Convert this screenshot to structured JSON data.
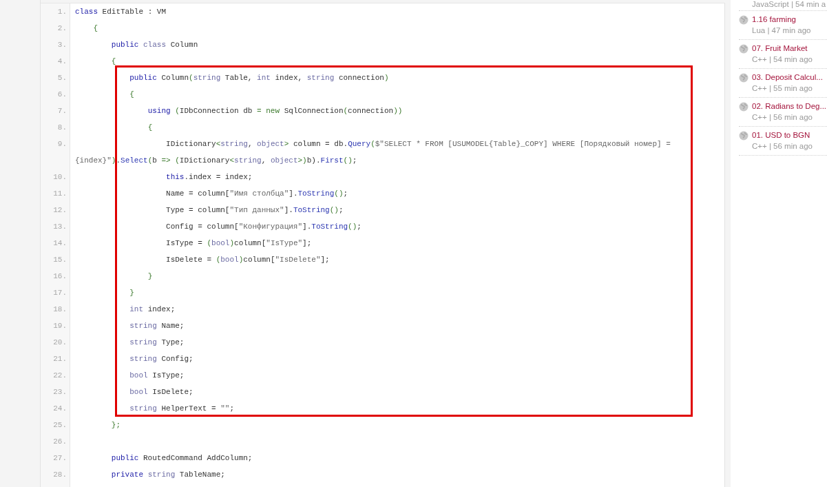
{
  "code": {
    "lines": [
      {
        "number": "1.",
        "tokens": [
          {
            "kind": "keyword",
            "text": "class"
          },
          {
            "kind": "plain",
            "text": " EditTable : VM"
          }
        ]
      },
      {
        "number": "2.",
        "tokens": [
          {
            "kind": "punct",
            "text": "    {"
          }
        ]
      },
      {
        "number": "3.",
        "tokens": [
          {
            "kind": "keyword",
            "text": "        public"
          },
          {
            "kind": "type",
            "text": " class"
          },
          {
            "kind": "plain",
            "text": " Column"
          }
        ]
      },
      {
        "number": "4.",
        "tokens": [
          {
            "kind": "punct",
            "text": "        {"
          }
        ]
      },
      {
        "number": "5.",
        "tokens": [
          {
            "kind": "keyword",
            "text": "            public"
          },
          {
            "kind": "plain",
            "text": " Column"
          },
          {
            "kind": "punct",
            "text": "("
          },
          {
            "kind": "type",
            "text": "string"
          },
          {
            "kind": "plain",
            "text": " Table, "
          },
          {
            "kind": "type",
            "text": "int"
          },
          {
            "kind": "plain",
            "text": " index, "
          },
          {
            "kind": "type",
            "text": "string"
          },
          {
            "kind": "plain",
            "text": " connection"
          },
          {
            "kind": "punct",
            "text": ")"
          }
        ]
      },
      {
        "number": "6.",
        "tokens": [
          {
            "kind": "punct",
            "text": "            {"
          }
        ]
      },
      {
        "number": "7.",
        "tokens": [
          {
            "kind": "keyword",
            "text": "                using"
          },
          {
            "kind": "punct",
            "text": " ("
          },
          {
            "kind": "plain",
            "text": "IDbConnection db "
          },
          {
            "kind": "punct",
            "text": "= new"
          },
          {
            "kind": "plain",
            "text": " SqlConnection"
          },
          {
            "kind": "punct",
            "text": "("
          },
          {
            "kind": "plain",
            "text": "connection"
          },
          {
            "kind": "punct",
            "text": "))"
          }
        ]
      },
      {
        "number": "8.",
        "tokens": [
          {
            "kind": "punct",
            "text": "                {"
          }
        ]
      },
      {
        "number": "9.",
        "tokens": [
          {
            "kind": "plain",
            "text": "                    IDictionary"
          },
          {
            "kind": "punct",
            "text": "<"
          },
          {
            "kind": "type",
            "text": "string"
          },
          {
            "kind": "plain",
            "text": ", "
          },
          {
            "kind": "type",
            "text": "object"
          },
          {
            "kind": "punct",
            "text": ">"
          },
          {
            "kind": "plain",
            "text": " column = db."
          },
          {
            "kind": "method",
            "text": "Query"
          },
          {
            "kind": "punct",
            "text": "("
          },
          {
            "kind": "string",
            "text": "$\"SELECT * FROM [USUMODEL{Table}_COPY] WHERE [Порядковый номер] = {index}\""
          },
          {
            "kind": "punct",
            "text": ")"
          },
          {
            "kind": "plain",
            "text": "."
          },
          {
            "kind": "method",
            "text": "Select"
          },
          {
            "kind": "punct",
            "text": "("
          },
          {
            "kind": "plain",
            "text": "b "
          },
          {
            "kind": "punct",
            "text": "=> ("
          },
          {
            "kind": "plain",
            "text": "IDictionary"
          },
          {
            "kind": "punct",
            "text": "<"
          },
          {
            "kind": "type",
            "text": "string"
          },
          {
            "kind": "plain",
            "text": ", "
          },
          {
            "kind": "type",
            "text": "object"
          },
          {
            "kind": "punct",
            "text": ">)"
          },
          {
            "kind": "plain",
            "text": "b)."
          },
          {
            "kind": "method",
            "text": "First"
          },
          {
            "kind": "punct",
            "text": "()"
          },
          {
            "kind": "plain",
            "text": ";"
          }
        ]
      },
      {
        "number": "10.",
        "tokens": [
          {
            "kind": "keyword",
            "text": "                    this"
          },
          {
            "kind": "plain",
            "text": ".index = index;"
          }
        ]
      },
      {
        "number": "11.",
        "tokens": [
          {
            "kind": "plain",
            "text": "                    Name = column["
          },
          {
            "kind": "string",
            "text": "\"Имя столбца\""
          },
          {
            "kind": "plain",
            "text": "]."
          },
          {
            "kind": "method",
            "text": "ToString"
          },
          {
            "kind": "punct",
            "text": "()"
          },
          {
            "kind": "plain",
            "text": ";"
          }
        ]
      },
      {
        "number": "12.",
        "tokens": [
          {
            "kind": "plain",
            "text": "                    Type = column["
          },
          {
            "kind": "string",
            "text": "\"Тип данных\""
          },
          {
            "kind": "plain",
            "text": "]."
          },
          {
            "kind": "method",
            "text": "ToString"
          },
          {
            "kind": "punct",
            "text": "()"
          },
          {
            "kind": "plain",
            "text": ";"
          }
        ]
      },
      {
        "number": "13.",
        "tokens": [
          {
            "kind": "plain",
            "text": "                    Config = column["
          },
          {
            "kind": "string",
            "text": "\"Конфигурация\""
          },
          {
            "kind": "plain",
            "text": "]."
          },
          {
            "kind": "method",
            "text": "ToString"
          },
          {
            "kind": "punct",
            "text": "()"
          },
          {
            "kind": "plain",
            "text": ";"
          }
        ]
      },
      {
        "number": "14.",
        "tokens": [
          {
            "kind": "plain",
            "text": "                    IsType = "
          },
          {
            "kind": "punct",
            "text": "("
          },
          {
            "kind": "type",
            "text": "bool"
          },
          {
            "kind": "punct",
            "text": ")"
          },
          {
            "kind": "plain",
            "text": "column["
          },
          {
            "kind": "string",
            "text": "\"IsType\""
          },
          {
            "kind": "plain",
            "text": "];"
          }
        ]
      },
      {
        "number": "15.",
        "tokens": [
          {
            "kind": "plain",
            "text": "                    IsDelete = "
          },
          {
            "kind": "punct",
            "text": "("
          },
          {
            "kind": "type",
            "text": "bool"
          },
          {
            "kind": "punct",
            "text": ")"
          },
          {
            "kind": "plain",
            "text": "column["
          },
          {
            "kind": "string",
            "text": "\"IsDelete\""
          },
          {
            "kind": "plain",
            "text": "];"
          }
        ]
      },
      {
        "number": "16.",
        "tokens": [
          {
            "kind": "punct",
            "text": "                }"
          }
        ]
      },
      {
        "number": "17.",
        "tokens": [
          {
            "kind": "punct",
            "text": "            }"
          }
        ]
      },
      {
        "number": "18.",
        "tokens": [
          {
            "kind": "type",
            "text": "            int"
          },
          {
            "kind": "plain",
            "text": " index;"
          }
        ]
      },
      {
        "number": "19.",
        "tokens": [
          {
            "kind": "type",
            "text": "            string"
          },
          {
            "kind": "plain",
            "text": " Name;"
          }
        ]
      },
      {
        "number": "20.",
        "tokens": [
          {
            "kind": "type",
            "text": "            string"
          },
          {
            "kind": "plain",
            "text": " Type;"
          }
        ]
      },
      {
        "number": "21.",
        "tokens": [
          {
            "kind": "type",
            "text": "            string"
          },
          {
            "kind": "plain",
            "text": " Config;"
          }
        ]
      },
      {
        "number": "22.",
        "tokens": [
          {
            "kind": "type",
            "text": "            bool"
          },
          {
            "kind": "plain",
            "text": " IsType;"
          }
        ]
      },
      {
        "number": "23.",
        "tokens": [
          {
            "kind": "type",
            "text": "            bool"
          },
          {
            "kind": "plain",
            "text": " IsDelete;"
          }
        ]
      },
      {
        "number": "24.",
        "tokens": [
          {
            "kind": "type",
            "text": "            string"
          },
          {
            "kind": "plain",
            "text": " HelperText = "
          },
          {
            "kind": "string",
            "text": "\"\""
          },
          {
            "kind": "plain",
            "text": ";"
          }
        ]
      },
      {
        "number": "25.",
        "tokens": [
          {
            "kind": "punct",
            "text": "        };"
          }
        ]
      },
      {
        "number": "26."
      },
      {
        "number": "27.",
        "tokens": [
          {
            "kind": "keyword",
            "text": "        public"
          },
          {
            "kind": "plain",
            "text": " RoutedCommand AddColumn;"
          }
        ]
      },
      {
        "number": "28.",
        "tokens": [
          {
            "kind": "keyword",
            "text": "        private"
          },
          {
            "kind": "type",
            "text": " string"
          },
          {
            "kind": "plain",
            "text": " TableName;"
          }
        ]
      }
    ]
  },
  "recent": [
    {
      "meta": "JavaScript | 54 min a"
    },
    {
      "title": "1.16 farming",
      "meta": "Lua | 47 min ago"
    },
    {
      "title": "07. Fruit Market",
      "meta": "C++ | 54 min ago"
    },
    {
      "title": "03. Deposit Calcul...",
      "meta": "C++ | 55 min ago"
    },
    {
      "title": "02. Radians to Deg...",
      "meta": "C++ | 56 min ago"
    },
    {
      "title": "01. USD to BGN",
      "meta": "C++ | 56 min ago"
    }
  ]
}
